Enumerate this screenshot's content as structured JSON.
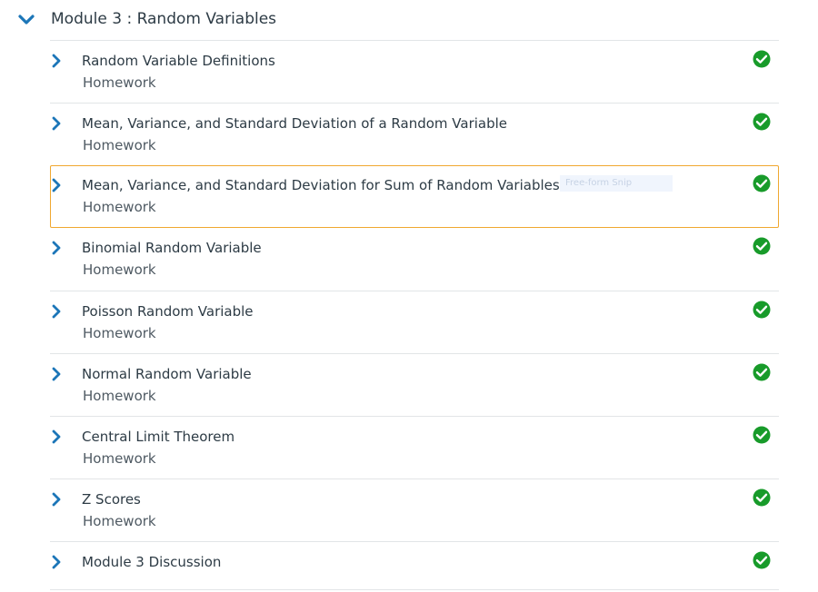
{
  "module": {
    "title": "Module 3 : Random Variables",
    "expand_icon": "chevron-down-icon"
  },
  "colors": {
    "chevron": "#1c76b8",
    "check": "#189b2a",
    "focus_border": "#f0a830",
    "divider": "#e2e5e7"
  },
  "items": [
    {
      "title": "Random Variable Definitions",
      "subtitle": "Homework",
      "status_icon": "completed-check-icon"
    },
    {
      "title": "Mean, Variance, and Standard Deviation of a Random Variable",
      "subtitle": "Homework",
      "status_icon": "completed-check-icon"
    },
    {
      "title": "Mean, Variance, and Standard Deviation for Sum of Random Variables",
      "subtitle": "Homework",
      "status_icon": "completed-check-icon",
      "focused": true,
      "overlay_text": "Free-form Snip"
    },
    {
      "title": "Binomial Random Variable",
      "subtitle": "Homework",
      "status_icon": "completed-check-icon"
    },
    {
      "title": "Poisson Random Variable",
      "subtitle": "Homework",
      "status_icon": "completed-check-icon"
    },
    {
      "title": "Normal Random Variable",
      "subtitle": "Homework",
      "status_icon": "completed-check-icon"
    },
    {
      "title": "Central Limit Theorem",
      "subtitle": "Homework",
      "status_icon": "completed-check-icon"
    },
    {
      "title": "Z Scores",
      "subtitle": "Homework",
      "status_icon": "completed-check-icon"
    },
    {
      "title": "Module 3 Discussion",
      "subtitle": "",
      "status_icon": "completed-check-icon"
    }
  ]
}
